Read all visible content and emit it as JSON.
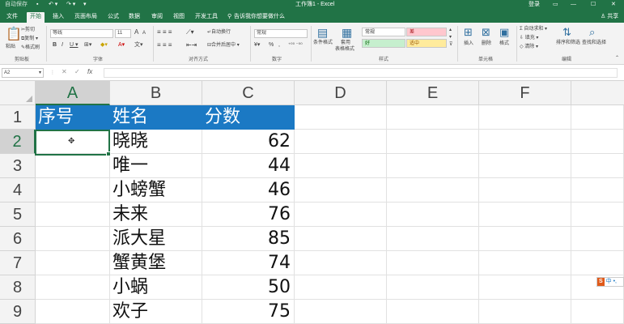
{
  "titlebar": {
    "autosave": "自动保存",
    "doc_title": "工作簿1 - Excel",
    "login": "登录",
    "restore_icon": "restore-icon",
    "minimize": "—",
    "maximize": "☐",
    "close": "✕"
  },
  "tabs": [
    "文件",
    "开始",
    "插入",
    "页面布局",
    "公式",
    "数据",
    "审阅",
    "视图",
    "开发工具"
  ],
  "active_tab": "开始",
  "tell_me": "告诉我你想要做什么",
  "share": "共享",
  "ribbon": {
    "clipboard": {
      "cut": "剪切",
      "copy": "复制 ▾",
      "format_painter": "格式刷",
      "group": "剪贴板",
      "paste": "粘贴"
    },
    "font": {
      "name": "等线",
      "size": "11",
      "bold": "B",
      "italic": "I",
      "underline": "U ▾",
      "group": "字体",
      "grow": "A",
      "shrink": "A",
      "color_a": "A"
    },
    "alignment": {
      "wrap": "自动换行",
      "merge": "合并后居中 ▾",
      "group": "对齐方式"
    },
    "number": {
      "format": "常规",
      "group": "数字",
      "percent": "%",
      "comma": ","
    },
    "styles": {
      "conditional": "条件格式",
      "table": "套用\n表格格式",
      "normal": "常规",
      "bad": "差",
      "good": "好",
      "neutral": "适中",
      "group": "样式"
    },
    "cells": {
      "insert": "插入",
      "delete": "删除",
      "format": "格式",
      "group": "单元格"
    },
    "editing": {
      "autosum": "自动求和 ▾",
      "fill": "填充 ▾",
      "clear": "清除 ▾",
      "sort": "排序和筛选",
      "find": "查找和选择",
      "group": "编辑"
    }
  },
  "namebox": "A2",
  "fx": "fx",
  "formula": "",
  "columns": [
    "A",
    "B",
    "C",
    "D",
    "E",
    "F"
  ],
  "selected_column": "A",
  "rows": [
    "1",
    "2",
    "3",
    "4",
    "5",
    "6",
    "7",
    "8",
    "9"
  ],
  "selected_row": "2",
  "table": {
    "headers": [
      "序号",
      "姓名",
      "分数"
    ],
    "records": [
      {
        "name": "晓晓",
        "score": "62"
      },
      {
        "name": "唯一",
        "score": "44"
      },
      {
        "name": "小螃蟹",
        "score": "46"
      },
      {
        "name": "未来",
        "score": "76"
      },
      {
        "name": "派大星",
        "score": "85"
      },
      {
        "name": "蟹黄堡",
        "score": "74"
      },
      {
        "name": "小蜗",
        "score": "50"
      },
      {
        "name": "欢子",
        "score": "75"
      }
    ]
  },
  "ime": {
    "logo": "S",
    "text": "中 •,"
  },
  "colors": {
    "excel_green": "#217346",
    "header_blue": "#1b79c4",
    "bad_bg": "#ffc7ce",
    "good_bg": "#c6efce",
    "neutral_bg": "#ffeb9c"
  }
}
